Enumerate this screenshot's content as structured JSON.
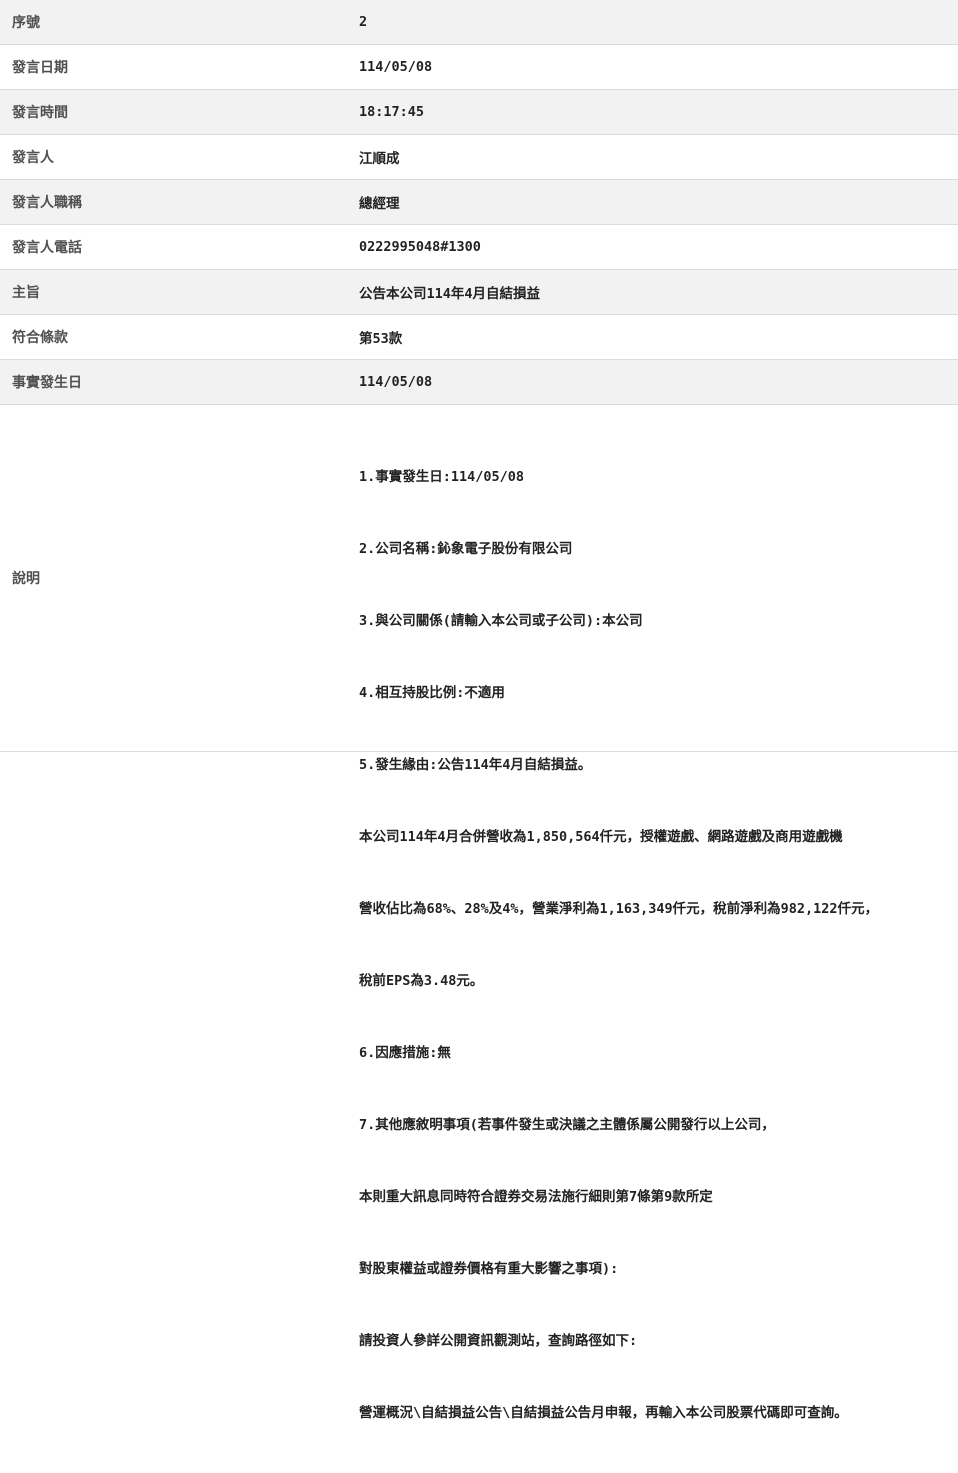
{
  "rows": [
    {
      "label": "序號",
      "value": "2"
    },
    {
      "label": "發言日期",
      "value": "114/05/08"
    },
    {
      "label": "發言時間",
      "value": "18:17:45"
    },
    {
      "label": "發言人",
      "value": "江順成"
    },
    {
      "label": "發言人職稱",
      "value": "總經理"
    },
    {
      "label": "發言人電話",
      "value": "0222995048#1300"
    },
    {
      "label": "主旨",
      "value": "公告本公司114年4月自結損益"
    },
    {
      "label": "符合條款",
      "value": "第53款"
    },
    {
      "label": "事實發生日",
      "value": "114/05/08"
    }
  ],
  "description": {
    "label": "說明",
    "lines": [
      "1.事實發生日:114/05/08",
      "2.公司名稱:鈊象電子股份有限公司",
      "3.與公司關係(請輸入本公司或子公司):本公司",
      "4.相互持股比例:不適用",
      "5.發生緣由:公告114年4月自結損益。",
      "本公司114年4月合併營收為1,850,564仟元，授權遊戲、網路遊戲及商用遊戲機",
      "營收佔比為68%、28%及4%，營業淨利為1,163,349仟元，稅前淨利為982,122仟元，",
      "稅前EPS為3.48元。",
      "6.因應措施:無",
      "7.其他應敘明事項(若事件發生或決議之主體係屬公開發行以上公司，",
      "本則重大訊息同時符合證券交易法施行細則第7條第9款所定",
      "對股東權益或證券價格有重大影響之事項):",
      "請投資人參詳公開資訊觀測站，查詢路徑如下:",
      "營運概況\\自結損益公告\\自結損益公告月申報，再輸入本公司股票代碼即可查詢。"
    ]
  }
}
